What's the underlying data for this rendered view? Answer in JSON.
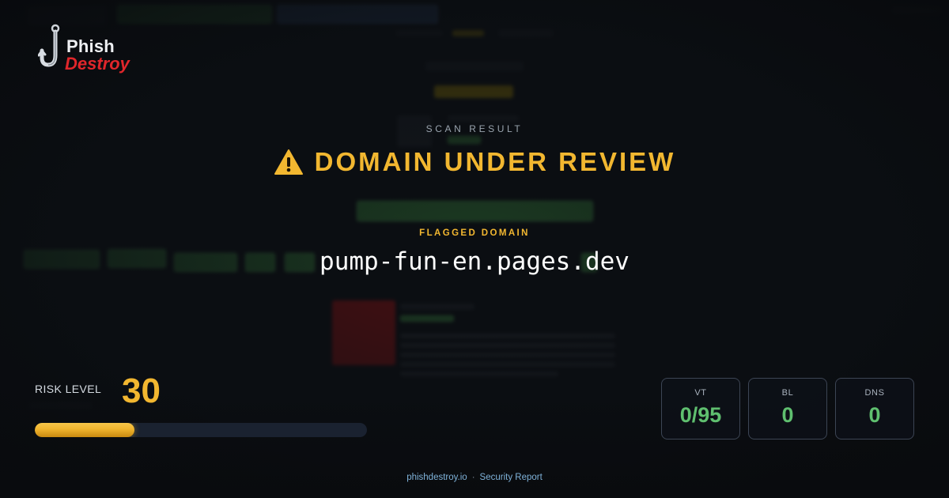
{
  "brand": {
    "name_line1": "Phish",
    "name_line2": "Destroy",
    "colors": {
      "primary_text": "#eef0f3",
      "accent_red": "#e0262b"
    }
  },
  "report": {
    "eyebrow": "SCAN RESULT",
    "status_icon": "warning-triangle-icon",
    "status": "DOMAIN UNDER REVIEW",
    "status_color": "#f2b730",
    "flagged_label": "FLAGGED DOMAIN",
    "domain": "pump-fun-en.pages.dev"
  },
  "risk": {
    "label": "RISK LEVEL",
    "value": "30",
    "fraction": 0.3
  },
  "stats": [
    {
      "label": "VT",
      "value": "0/95"
    },
    {
      "label": "BL",
      "value": "0"
    },
    {
      "label": "DNS",
      "value": "0"
    }
  ],
  "stat_value_color": "#5fbf6f",
  "footer": {
    "site": "phishdestroy.io",
    "separator": "·",
    "label": "Security Report"
  }
}
